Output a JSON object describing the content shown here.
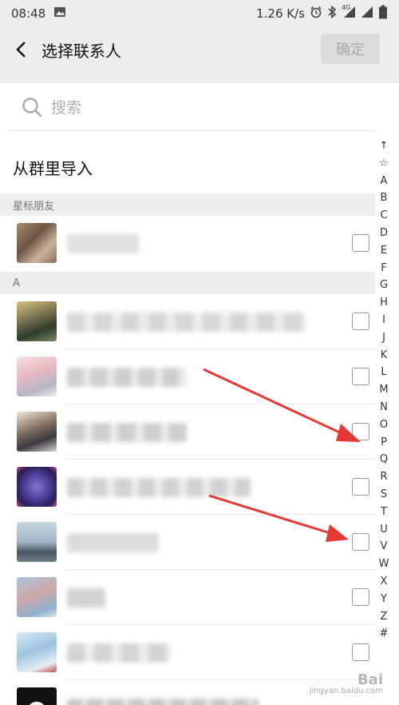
{
  "status_bar": {
    "time": "08:48",
    "speed": "1.26 K/s",
    "network": "4G"
  },
  "nav": {
    "title": "选择联系人",
    "confirm_label": "确定"
  },
  "search": {
    "placeholder": "搜索"
  },
  "import_row": {
    "label": "从群里导入"
  },
  "sections": [
    {
      "label": "星标朋友"
    },
    {
      "label": "A"
    }
  ],
  "index_bar": [
    "↑",
    "☆",
    "A",
    "B",
    "C",
    "D",
    "E",
    "F",
    "G",
    "H",
    "I",
    "J",
    "K",
    "L",
    "M",
    "N",
    "O",
    "P",
    "Q",
    "R",
    "S",
    "T",
    "U",
    "V",
    "W",
    "X",
    "Y",
    "Z",
    "#"
  ],
  "watermark": {
    "line1": "Bai",
    "line2": "jingyan.baidu.com"
  },
  "colors": {
    "accent_arrow": "#e53935",
    "background": "#ededed"
  }
}
